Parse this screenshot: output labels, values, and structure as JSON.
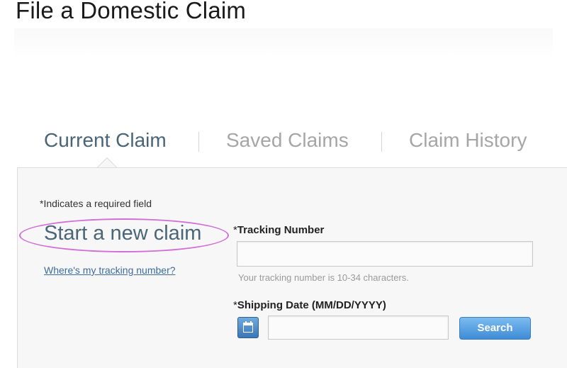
{
  "page": {
    "title": "File a Domestic Claim"
  },
  "tabs": [
    {
      "label": "Current Claim",
      "active": true
    },
    {
      "label": "Saved Claims",
      "active": false
    },
    {
      "label": "Claim History",
      "active": false
    }
  ],
  "form": {
    "required_note": "*Indicates a required field",
    "heading": "Start a new claim",
    "tracking_link": "Where's my tracking number?",
    "tracking_field": {
      "required_mark": "*",
      "label": "Tracking Number",
      "value": "",
      "help": "Your tracking number is 10-34 characters."
    },
    "date_field": {
      "required_mark": "*",
      "label": "Shipping Date (MM/DD/YYYY)",
      "value": ""
    },
    "search_button": "Search"
  },
  "icons": {
    "calendar": "calendar-icon"
  },
  "colors": {
    "active_tab": "#4a6478",
    "inactive_tab": "#a6a6a6",
    "link": "#3d6c9c",
    "highlight_oval": "#d16fd6",
    "button": "#3f8bd6"
  }
}
